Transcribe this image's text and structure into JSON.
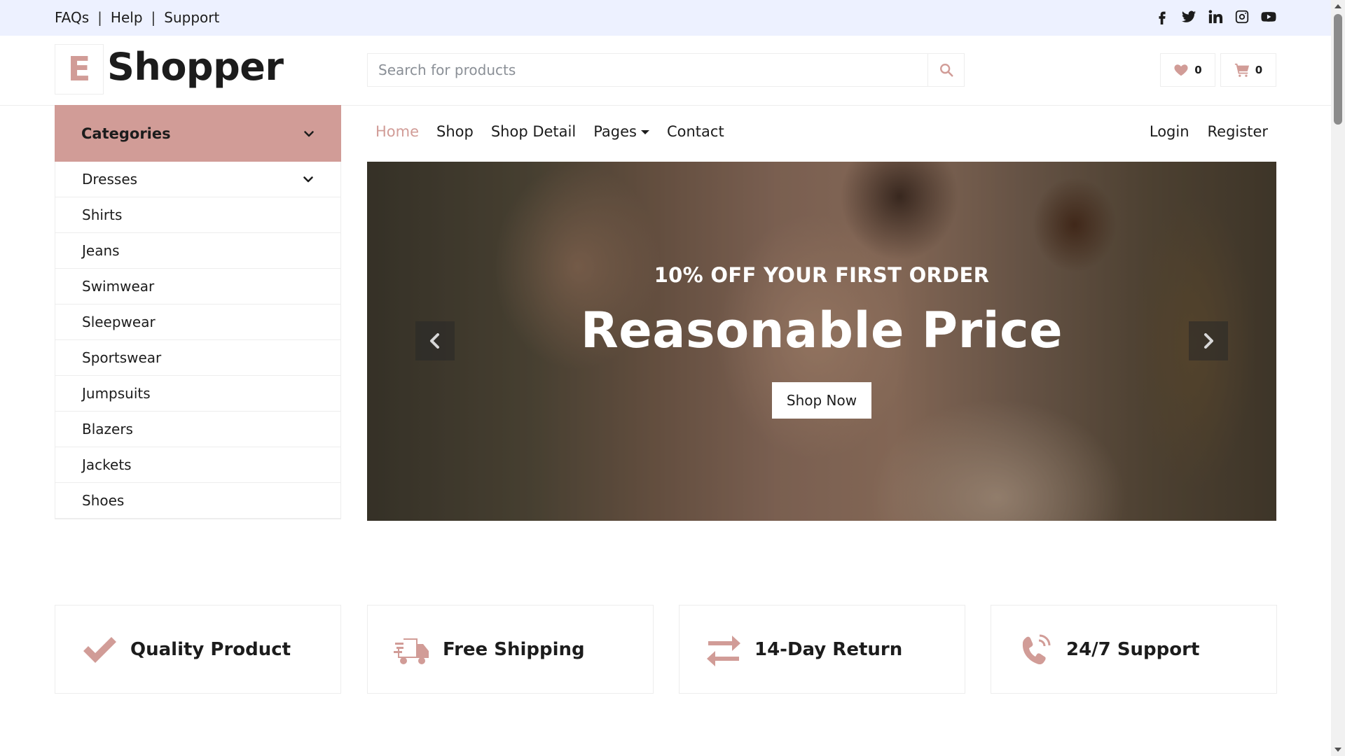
{
  "topbar": {
    "links": [
      "FAQs",
      "Help",
      "Support"
    ],
    "separator": "|",
    "socials": [
      "facebook-icon",
      "twitter-icon",
      "linkedin-icon",
      "instagram-icon",
      "youtube-icon"
    ]
  },
  "brand": {
    "logo_letter": "E",
    "name": "Shopper",
    "accent_color": "#d19c97"
  },
  "search": {
    "placeholder": "Search for products"
  },
  "header_buttons": {
    "wishlist_count": "0",
    "cart_count": "0"
  },
  "categories": {
    "title": "Categories",
    "items": [
      "Dresses",
      "Shirts",
      "Jeans",
      "Swimwear",
      "Sleepwear",
      "Sportswear",
      "Jumpsuits",
      "Blazers",
      "Jackets",
      "Shoes"
    ]
  },
  "nav": {
    "items": [
      "Home",
      "Shop",
      "Shop Detail",
      "Pages",
      "Contact"
    ],
    "active": "Home",
    "auth": [
      "Login",
      "Register"
    ]
  },
  "hero": {
    "subtitle": "10% OFF YOUR FIRST ORDER",
    "title": "Reasonable Price",
    "button": "Shop Now"
  },
  "features": [
    {
      "icon": "check-icon",
      "label": "Quality Product"
    },
    {
      "icon": "shipping-truck-icon",
      "label": "Free Shipping"
    },
    {
      "icon": "exchange-arrows-icon",
      "label": "14-Day Return"
    },
    {
      "icon": "phone-volume-icon",
      "label": "24/7 Support"
    }
  ]
}
